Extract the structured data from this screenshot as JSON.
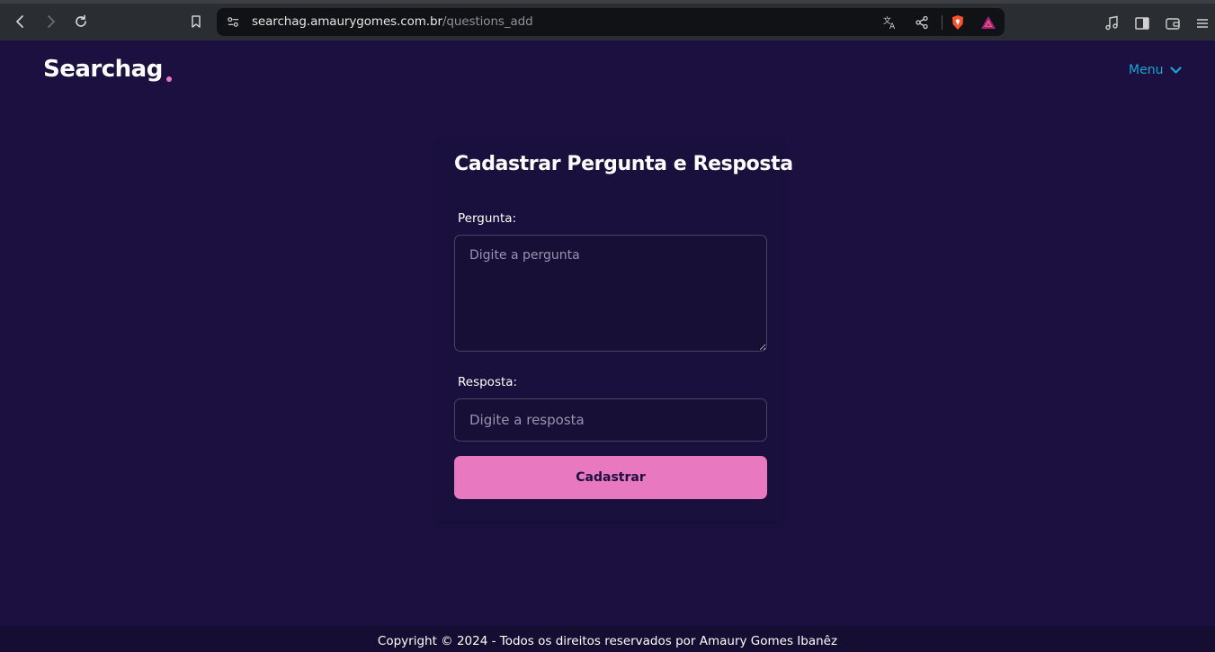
{
  "browser": {
    "url_domain": "searchag.amaurygomes.com.br",
    "url_path": "/questions_add"
  },
  "header": {
    "logo_text": "Searchag",
    "menu_label": "Menu"
  },
  "form": {
    "title": "Cadastrar Pergunta e Resposta",
    "question_label": "Pergunta:",
    "question_placeholder": "Digite a pergunta",
    "answer_label": "Resposta:",
    "answer_placeholder": "Digite a resposta",
    "submit_label": "Cadastrar"
  },
  "footer": {
    "text": "Copyright © 2024 - Todos os direitos reservados por Amaury Gomes Ibanêz"
  },
  "colors": {
    "page_background": "#1b1040",
    "accent_pink": "#e879c0",
    "menu_blue": "#1aa6d6"
  },
  "icons": [
    "back-icon",
    "forward-icon",
    "reload-icon",
    "bookmark-icon",
    "site-settings-icon",
    "translate-icon",
    "share-icon",
    "brave-shields-icon",
    "brave-rewards-icon",
    "media-icon",
    "sidebar-icon",
    "wallet-icon",
    "hamburger-menu-icon",
    "chevron-down-icon"
  ]
}
